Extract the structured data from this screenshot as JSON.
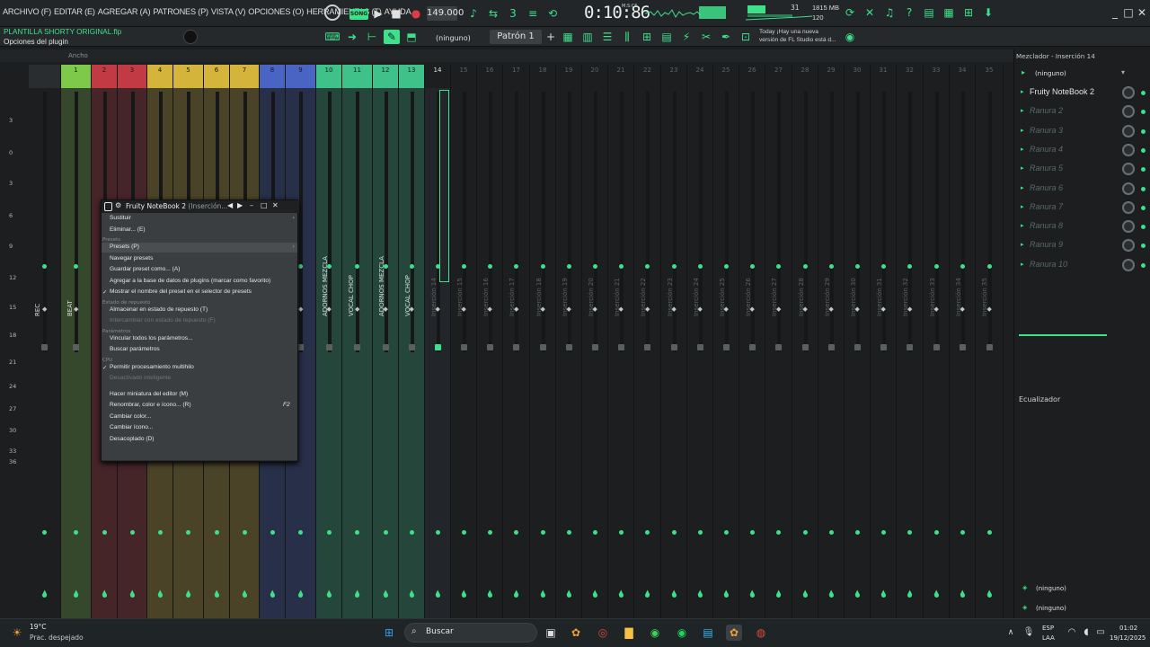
{
  "menubar": {
    "items": [
      "ARCHIVO (F)",
      "EDITAR (E)",
      "AGREGAR (A)",
      "PATRONES (P)",
      "VISTA (V)",
      "OPCIONES (O)",
      "HERRAMIENTAS (T)",
      "AYUDA"
    ],
    "song_mode": "SONG",
    "tempo": "149.000",
    "time": "0:10:86",
    "time_sub": "M:S:CS",
    "cpu_voices": "31",
    "memory_mb": "1815 MB",
    "memory_sub": "120"
  },
  "bar2": {
    "project": "PLANTILLA SHORTY ORIGINAL.flp",
    "context": "Opciones del plugin",
    "snap": "(ninguno)",
    "pattern": "Patrón 1",
    "news_line1": "Today ¡Hay una nueva",
    "news_line2": "versión de FL Studio está d..."
  },
  "mixer": {
    "width_label": "Ancho",
    "scale": [
      "3",
      "0",
      "3",
      "6",
      "9",
      "12",
      "15",
      "18",
      "21",
      "24",
      "27",
      "30",
      "33",
      "36"
    ],
    "tracks": [
      {
        "num": "",
        "name": "REC",
        "color": "#2a2d2f"
      },
      {
        "num": "1",
        "name": "BEAT",
        "color": "#7fc94a"
      },
      {
        "num": "2",
        "name": "",
        "color": "#c23a44"
      },
      {
        "num": "3",
        "name": "",
        "color": "#c23a44"
      },
      {
        "num": "4",
        "name": "",
        "color": "#d4b43a"
      },
      {
        "num": "5",
        "name": "",
        "color": "#d4b43a"
      },
      {
        "num": "6",
        "name": "",
        "color": "#d4b43a"
      },
      {
        "num": "7",
        "name": "",
        "color": "#d4b43a"
      },
      {
        "num": "8",
        "name": "",
        "color": "#4a64c4"
      },
      {
        "num": "9",
        "name": "",
        "color": "#4a64c4"
      },
      {
        "num": "10",
        "name": "ADORNOS MEZCLA",
        "color": "#3fc28a"
      },
      {
        "num": "11",
        "name": "VOCAL CHOP",
        "color": "#3fc28a"
      },
      {
        "num": "12",
        "name": "ADORNOS MEZCLA",
        "color": "#3fc28a"
      },
      {
        "num": "13",
        "name": "VOCAL CHOP",
        "color": "#3fc28a"
      },
      {
        "num": "14",
        "name": "Inserción 14",
        "color": "#1c1e20"
      },
      {
        "num": "15",
        "name": "Inserción 15",
        "color": "#1c1e20"
      },
      {
        "num": "16",
        "name": "Inserción 16",
        "color": "#1c1e20"
      },
      {
        "num": "17",
        "name": "Inserción 17",
        "color": "#1c1e20"
      },
      {
        "num": "18",
        "name": "Inserción 18",
        "color": "#1c1e20"
      },
      {
        "num": "19",
        "name": "Inserción 19",
        "color": "#1c1e20"
      },
      {
        "num": "20",
        "name": "Inserción 20",
        "color": "#1c1e20"
      },
      {
        "num": "21",
        "name": "Inserción 21",
        "color": "#1c1e20"
      },
      {
        "num": "22",
        "name": "Inserción 22",
        "color": "#1c1e20"
      },
      {
        "num": "23",
        "name": "Inserción 23",
        "color": "#1c1e20"
      },
      {
        "num": "24",
        "name": "Inserción 24",
        "color": "#1c1e20"
      },
      {
        "num": "25",
        "name": "Inserción 25",
        "color": "#1c1e20"
      },
      {
        "num": "26",
        "name": "Inserción 26",
        "color": "#1c1e20"
      },
      {
        "num": "27",
        "name": "Inserción 27",
        "color": "#1c1e20"
      },
      {
        "num": "28",
        "name": "Inserción 28",
        "color": "#1c1e20"
      },
      {
        "num": "29",
        "name": "Inserción 29",
        "color": "#1c1e20"
      },
      {
        "num": "30",
        "name": "Inserción 30",
        "color": "#1c1e20"
      },
      {
        "num": "31",
        "name": "Inserción 31",
        "color": "#1c1e20"
      },
      {
        "num": "32",
        "name": "Inserción 32",
        "color": "#1c1e20"
      },
      {
        "num": "33",
        "name": "Inserción 33",
        "color": "#1c1e20"
      },
      {
        "num": "34",
        "name": "Inserción 34",
        "color": "#1c1e20"
      },
      {
        "num": "35",
        "name": "Inserción 35",
        "color": "#1c1e20"
      }
    ]
  },
  "plugin_window": {
    "title": "Fruity NoteBook 2",
    "title_sub": "(Inserción..."
  },
  "context_menu": {
    "items": [
      {
        "label": "Sustituir",
        "type": "item",
        "arrow": true
      },
      {
        "label": "Eliminar... (E)",
        "type": "item"
      },
      {
        "label": "Presets",
        "type": "header"
      },
      {
        "label": "Presets (P)",
        "type": "item",
        "arrow": true,
        "highlight": true
      },
      {
        "label": "Navegar presets",
        "type": "item"
      },
      {
        "label": "Guardar preset como... (A)",
        "type": "item"
      },
      {
        "label": "Agregar a la base de datos de plugins (marcar como favorito)",
        "type": "item"
      },
      {
        "label": "Mostrar el nombre del preset en el selector de presets",
        "type": "item",
        "checked": true
      },
      {
        "label": "Estado de repuesto",
        "type": "header"
      },
      {
        "label": "Almacenar en estado de repuesto (T)",
        "type": "item"
      },
      {
        "label": "Intercambiar con estado de repuesto (F)",
        "type": "item",
        "disabled": true
      },
      {
        "label": "Parámetros",
        "type": "header"
      },
      {
        "label": "Vincular todos los parámetros...",
        "type": "item"
      },
      {
        "label": "Buscar parámetros",
        "type": "item"
      },
      {
        "label": "CPU",
        "type": "header"
      },
      {
        "label": "Permitir procesamiento multihilo",
        "type": "item",
        "checked": true
      },
      {
        "label": "Desactivado inteligente",
        "type": "item",
        "disabled": true
      },
      {
        "label": "",
        "type": "spacer"
      },
      {
        "label": "Hacer miniatura del editor (M)",
        "type": "item"
      },
      {
        "label": "Renombrar, color e ícono... (R)",
        "type": "item",
        "key": "F2"
      },
      {
        "label": "Cambiar color...",
        "type": "item"
      },
      {
        "label": "Cambiar ícono...",
        "type": "item"
      },
      {
        "label": "Desacoplado (D)",
        "type": "item"
      }
    ]
  },
  "right_panel": {
    "title": "Mezclador - Inserción 14",
    "preset": "(ninguno)",
    "slots": [
      "Fruity NoteBook 2",
      "Ranura 2",
      "Ranura 3",
      "Ranura 4",
      "Ranura 5",
      "Ranura 6",
      "Ranura 7",
      "Ranura 8",
      "Ranura 9",
      "Ranura 10"
    ],
    "eq_label": "Ecualizador",
    "bottom1": "(ninguno)",
    "bottom2": "(ninguno)"
  },
  "taskbar": {
    "weather_temp": "19°C",
    "weather_desc": "Prac. despejado",
    "search": "Buscar",
    "lang1": "ESP",
    "lang2": "LAA",
    "time": "01:02",
    "date": "19/12/2025"
  },
  "colors": {
    "accent": "#3ee08a"
  }
}
